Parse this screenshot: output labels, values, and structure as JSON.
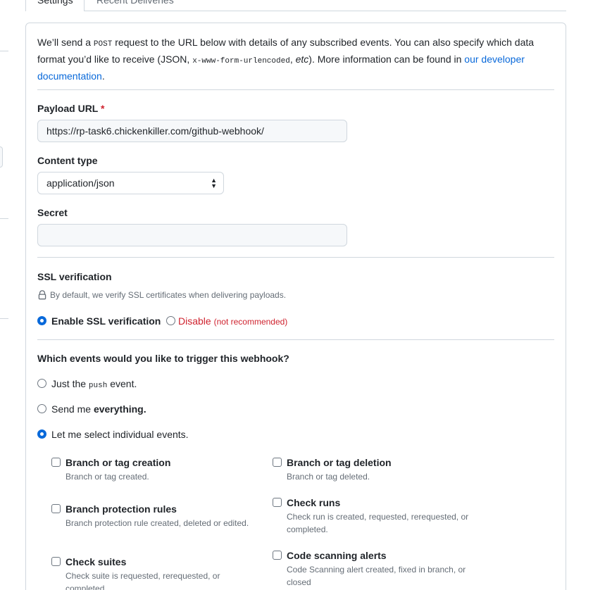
{
  "tabs": {
    "settings": "Settings",
    "recent_deliveries": "Recent Deliveries"
  },
  "intro": {
    "part1": "We’ll send a ",
    "post": "POST",
    "part2": " request to the URL below with details of any subscribed events. You can also specify which data format you’d like to receive (JSON, ",
    "urlencoded": "x-www-form-urlencoded",
    "part3": ", ",
    "etc": "etc",
    "part4": "). More information can be found in ",
    "link": "our developer documentation",
    "part5": "."
  },
  "payload": {
    "label": "Payload URL",
    "required": "*",
    "value": "https://rp-task6.chickenkiller.com/github-webhook/"
  },
  "content_type": {
    "label": "Content type",
    "value": "application/json"
  },
  "secret": {
    "label": "Secret",
    "value": ""
  },
  "ssl": {
    "label": "SSL verification",
    "note": "By default, we verify SSL certificates when delivering payloads.",
    "enable": "Enable SSL verification",
    "disable": "Disable",
    "disable_note": "(not recommended)"
  },
  "events": {
    "question": "Which events would you like to trigger this webhook?",
    "push_pre": "Just the ",
    "push_code": "push",
    "push_post": " event.",
    "everything_pre": "Send me ",
    "everything_bold": "everything.",
    "individual": "Let me select individual events.",
    "items": [
      {
        "title": "Branch or tag creation",
        "desc": "Branch or tag created."
      },
      {
        "title": "Branch or tag deletion",
        "desc": "Branch or tag deleted."
      },
      {
        "title": "Branch protection rules",
        "desc": "Branch protection rule created, deleted or edited."
      },
      {
        "title": "Check runs",
        "desc": "Check run is created, requested, rerequested, or completed."
      },
      {
        "title": "Check suites",
        "desc": "Check suite is requested, rerequested, or completed."
      },
      {
        "title": "Code scanning alerts",
        "desc": "Code Scanning alert created, fixed in branch, or closed"
      }
    ]
  },
  "colors": {
    "accent": "#0969da",
    "danger": "#cf222e",
    "border": "#d0d7de",
    "muted": "#656d76"
  }
}
